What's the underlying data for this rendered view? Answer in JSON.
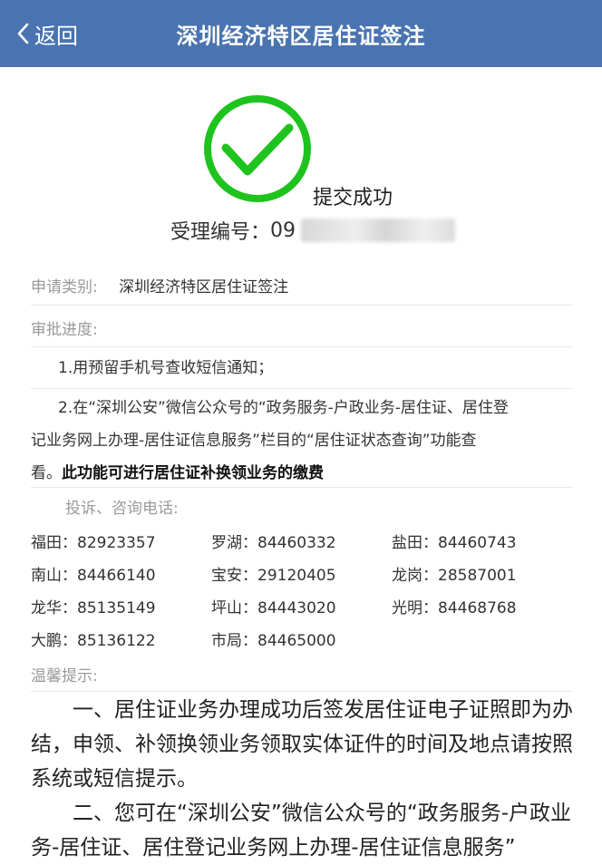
{
  "header": {
    "back_label": "返回",
    "title": "深圳经济特区居住证签注"
  },
  "status": {
    "icon": "check-circle-icon",
    "color": "#1ec31e",
    "text": "提交成功",
    "ref_label": "受理编号：",
    "ref_value_visible": "09"
  },
  "info": {
    "category_label": "申请类别:",
    "category_value": "深圳经济特区居住证签注",
    "progress_label": "审批进度:",
    "step1": "1.用预留手机号查收短信通知；",
    "step2_line1": "2.在“深圳公安”微信公众号的“政务服务-户政业务-居住证、居住登",
    "step2_line2": "记业务网上办理-居住证信息服务”栏目的“居住证状态查询”功能查",
    "step2_line3_plain": "看。",
    "step2_line3_bold": "此功能可进行居住证补换领业务的缴费"
  },
  "contacts": {
    "label": "投诉、咨询电话:",
    "items": [
      {
        "name": "福田",
        "phone": "82923357"
      },
      {
        "name": "罗湖",
        "phone": "84460332"
      },
      {
        "name": "盐田",
        "phone": "84460743"
      },
      {
        "name": "南山",
        "phone": "84466140"
      },
      {
        "name": "宝安",
        "phone": "29120405"
      },
      {
        "name": "龙岗",
        "phone": "28587001"
      },
      {
        "name": "龙华",
        "phone": "85135149"
      },
      {
        "name": "坪山",
        "phone": "84443020"
      },
      {
        "name": "光明",
        "phone": "84468768"
      },
      {
        "name": "大鹏",
        "phone": "85136122"
      },
      {
        "name": "市局",
        "phone": "84465000"
      }
    ]
  },
  "tips": {
    "label": "温馨提示:",
    "para1": "一、居住证业务办理成功后签发居住证电子证照即为办结，申领、补领换领业务领取实体证件的时间及地点请按照系统或短信提示。",
    "para2": "二、您可在“深圳公安”微信公众号的“政务服务-户政业务-居住证、居住登记业务网上办理-居住证信息服务”"
  }
}
